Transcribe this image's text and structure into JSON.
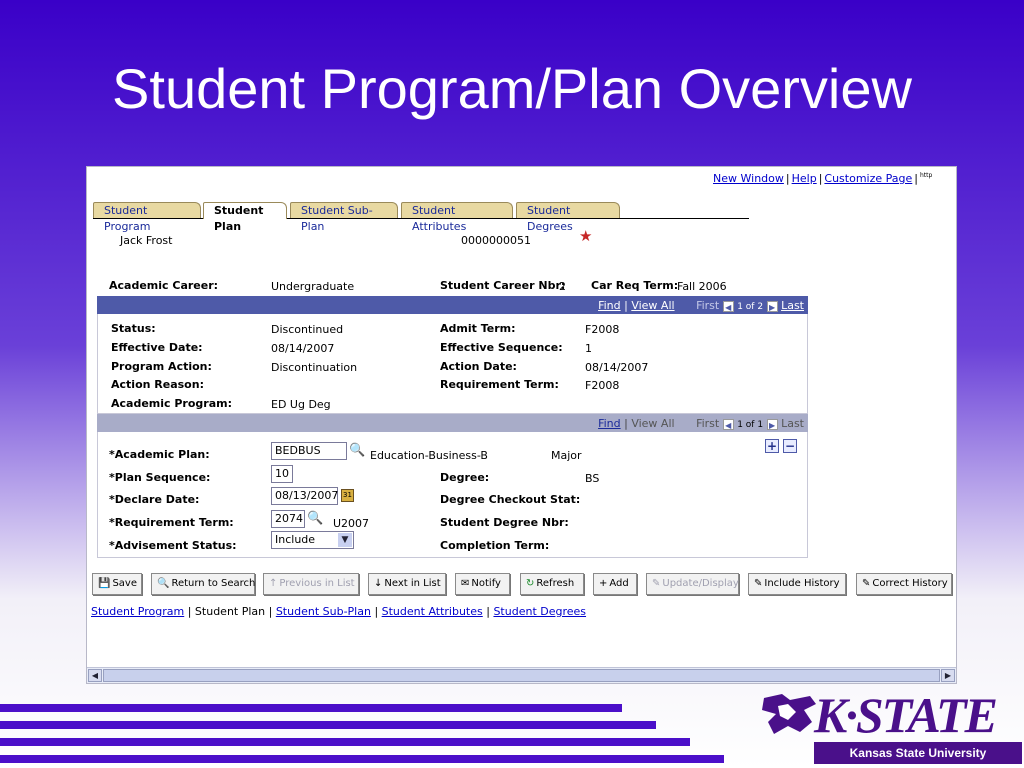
{
  "slide": {
    "title": "Student Program/Plan Overview"
  },
  "toplinks": {
    "new_window": "New Window",
    "help": "Help",
    "customize": "Customize Page",
    "http": "http"
  },
  "tabs": [
    {
      "label": "Student Program"
    },
    {
      "label": "Student Plan"
    },
    {
      "label": "Student Sub-Plan"
    },
    {
      "label": "Student Attributes"
    },
    {
      "label": "Student Degrees"
    }
  ],
  "student": {
    "name": "Jack  Frost",
    "id": "0000000051"
  },
  "career": {
    "academic_career_label": "Academic Career:",
    "academic_career": "Undergraduate",
    "career_nbr_label": "Student Career Nbr:",
    "career_nbr": "2",
    "req_term_label": "Car Req Term:",
    "req_term": "Fall 2006"
  },
  "nav1": {
    "find": "Find",
    "view_all": "View All",
    "first": "First",
    "counter": "1 of 2",
    "last": "Last"
  },
  "program": {
    "status_label": "Status:",
    "status": "Discontinued",
    "eff_date_label": "Effective Date:",
    "eff_date": "08/14/2007",
    "prog_action_label": "Program Action:",
    "prog_action": "Discontinuation",
    "action_reason_label": "Action Reason:",
    "acad_program_label": "Academic Program:",
    "acad_program": "ED Ug Deg",
    "admit_term_label": "Admit Term:",
    "admit_term": "F2008",
    "eff_seq_label": "Effective Sequence:",
    "eff_seq": "1",
    "action_date_label": "Action Date:",
    "action_date": "08/14/2007",
    "req_term_label": "Requirement Term:",
    "req_term": "F2008"
  },
  "nav2": {
    "find": "Find",
    "view_all": "View All",
    "first": "First",
    "counter": "1 of 1",
    "last": "Last"
  },
  "plan": {
    "acad_plan_label": "*Academic Plan:",
    "acad_plan": "BEDBUS",
    "acad_plan_desc": "Education-Business-B",
    "plan_type": "Major",
    "plan_seq_label": "*Plan Sequence:",
    "plan_seq": "10",
    "declare_date_label": "*Declare Date:",
    "declare_date": "08/13/2007",
    "req_term_label": "*Requirement Term:",
    "req_term": "2074",
    "req_term_desc": "U2007",
    "advisement_label": "*Advisement Status:",
    "advisement": "Include",
    "degree_label": "Degree:",
    "degree": "BS",
    "checkout_label": "Degree Checkout Stat:",
    "degree_nbr_label": "Student Degree Nbr:",
    "completion_label": "Completion Term:"
  },
  "toolbar": {
    "save": "Save",
    "return": "Return to Search",
    "prev": "Previous in List",
    "next": "Next in List",
    "notify": "Notify",
    "refresh": "Refresh",
    "add": "Add",
    "update": "Update/Display",
    "include_history": "Include History",
    "correct_history": "Correct History"
  },
  "bottomlinks": [
    {
      "label": "Student Program"
    },
    {
      "label": "Student Plan"
    },
    {
      "label": "Student Sub-Plan"
    },
    {
      "label": "Student Attributes"
    },
    {
      "label": "Student Degrees"
    }
  ],
  "logo": {
    "wordmark": "K·STATE",
    "tagline": "Kansas State University"
  },
  "colors": {
    "slide_bg": "#3a00c8",
    "nav_bar": "#4e5aa8",
    "tab_bg": "#e8d9a2",
    "stripe": "#4b0fc9",
    "brand": "#4a108a"
  }
}
